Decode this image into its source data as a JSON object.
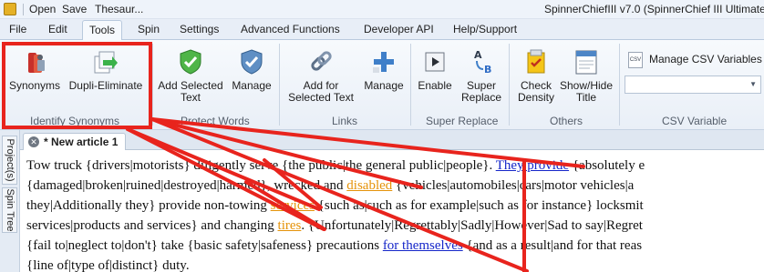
{
  "quick_access": {
    "open": "Open",
    "save": "Save",
    "thesaurus": "Thesaur..."
  },
  "app_title": "SpinnerChiefIII v7.0 (SpinnerChief III Ultimate E",
  "ribbon_tabs": [
    "File",
    "Edit",
    "Tools",
    "Spin",
    "Settings",
    "Advanced Functions",
    "Developer API",
    "Help/Support"
  ],
  "active_tab": "Tools",
  "groups": {
    "identify_synonyms": {
      "label": "Identify Synonyms",
      "synonyms": "Synonyms",
      "dupli_eliminate": "Dupli-Eliminate"
    },
    "protect_words": {
      "label": "Protect Words",
      "add_selected_text": [
        "Add Selected",
        "Text"
      ],
      "manage": "Manage"
    },
    "links": {
      "label": "Links",
      "add_for_selected_text": [
        "Add for",
        "Selected Text"
      ],
      "manage": "Manage"
    },
    "super_replace": {
      "label": "Super Replace",
      "enable": "Enable",
      "super_replace": [
        "Super",
        "Replace"
      ]
    },
    "others": {
      "label": "Others",
      "check_density": [
        "Check",
        "Density"
      ],
      "show_hide_title": [
        "Show/Hide",
        "Title"
      ]
    },
    "csv_variable": {
      "label": "CSV Variable",
      "manage_csv": "Manage CSV Variables",
      "csv_icon_text": "CSV",
      "dropdown_value": ""
    }
  },
  "side_tabs": {
    "projects": "Project(s)",
    "spin_tree": "Spin Tree"
  },
  "document": {
    "tab_title": "* New article 1",
    "lines": [
      [
        {
          "t": "Tow truck {drivers|motorists} diligently serve {the public|the general public|people}. ",
          "s": ""
        },
        {
          "t": "They provide",
          "s": "blue"
        },
        {
          "t": " {absolutely e",
          "s": ""
        }
      ],
      [
        {
          "t": "{damaged|broken|ruined|destroyed|harmed}, wrecked and ",
          "s": ""
        },
        {
          "t": "disabled",
          "s": "orange"
        },
        {
          "t": " {vehicles|automobiles|cars|motor vehicles|a",
          "s": ""
        }
      ],
      [
        {
          "t": "they|Additionally they} provide non-towing ",
          "s": ""
        },
        {
          "t": "services",
          "s": "orange"
        },
        {
          "t": " {such as|such as for example|such as for instance} locksmit",
          "s": ""
        }
      ],
      [
        {
          "t": "services|products and services} and changing ",
          "s": ""
        },
        {
          "t": "tires",
          "s": "orange"
        },
        {
          "t": ". {Unfortunately|Regrettably|Sadly|However|Sad to say|Regret",
          "s": ""
        }
      ],
      [
        {
          "t": "{fail to|neglect to|don't} take {basic safety|safeness} precautions ",
          "s": ""
        },
        {
          "t": "for themselves",
          "s": "blue"
        },
        {
          "t": " {and as a result|and for that reas",
          "s": ""
        }
      ],
      [
        {
          "t": "{line of|type of|distinct} duty.",
          "s": ""
        }
      ]
    ]
  },
  "colors": {
    "annotation_red": "#e8241d",
    "keyword_orange": "#e59208",
    "link_blue": "#1526c9"
  }
}
